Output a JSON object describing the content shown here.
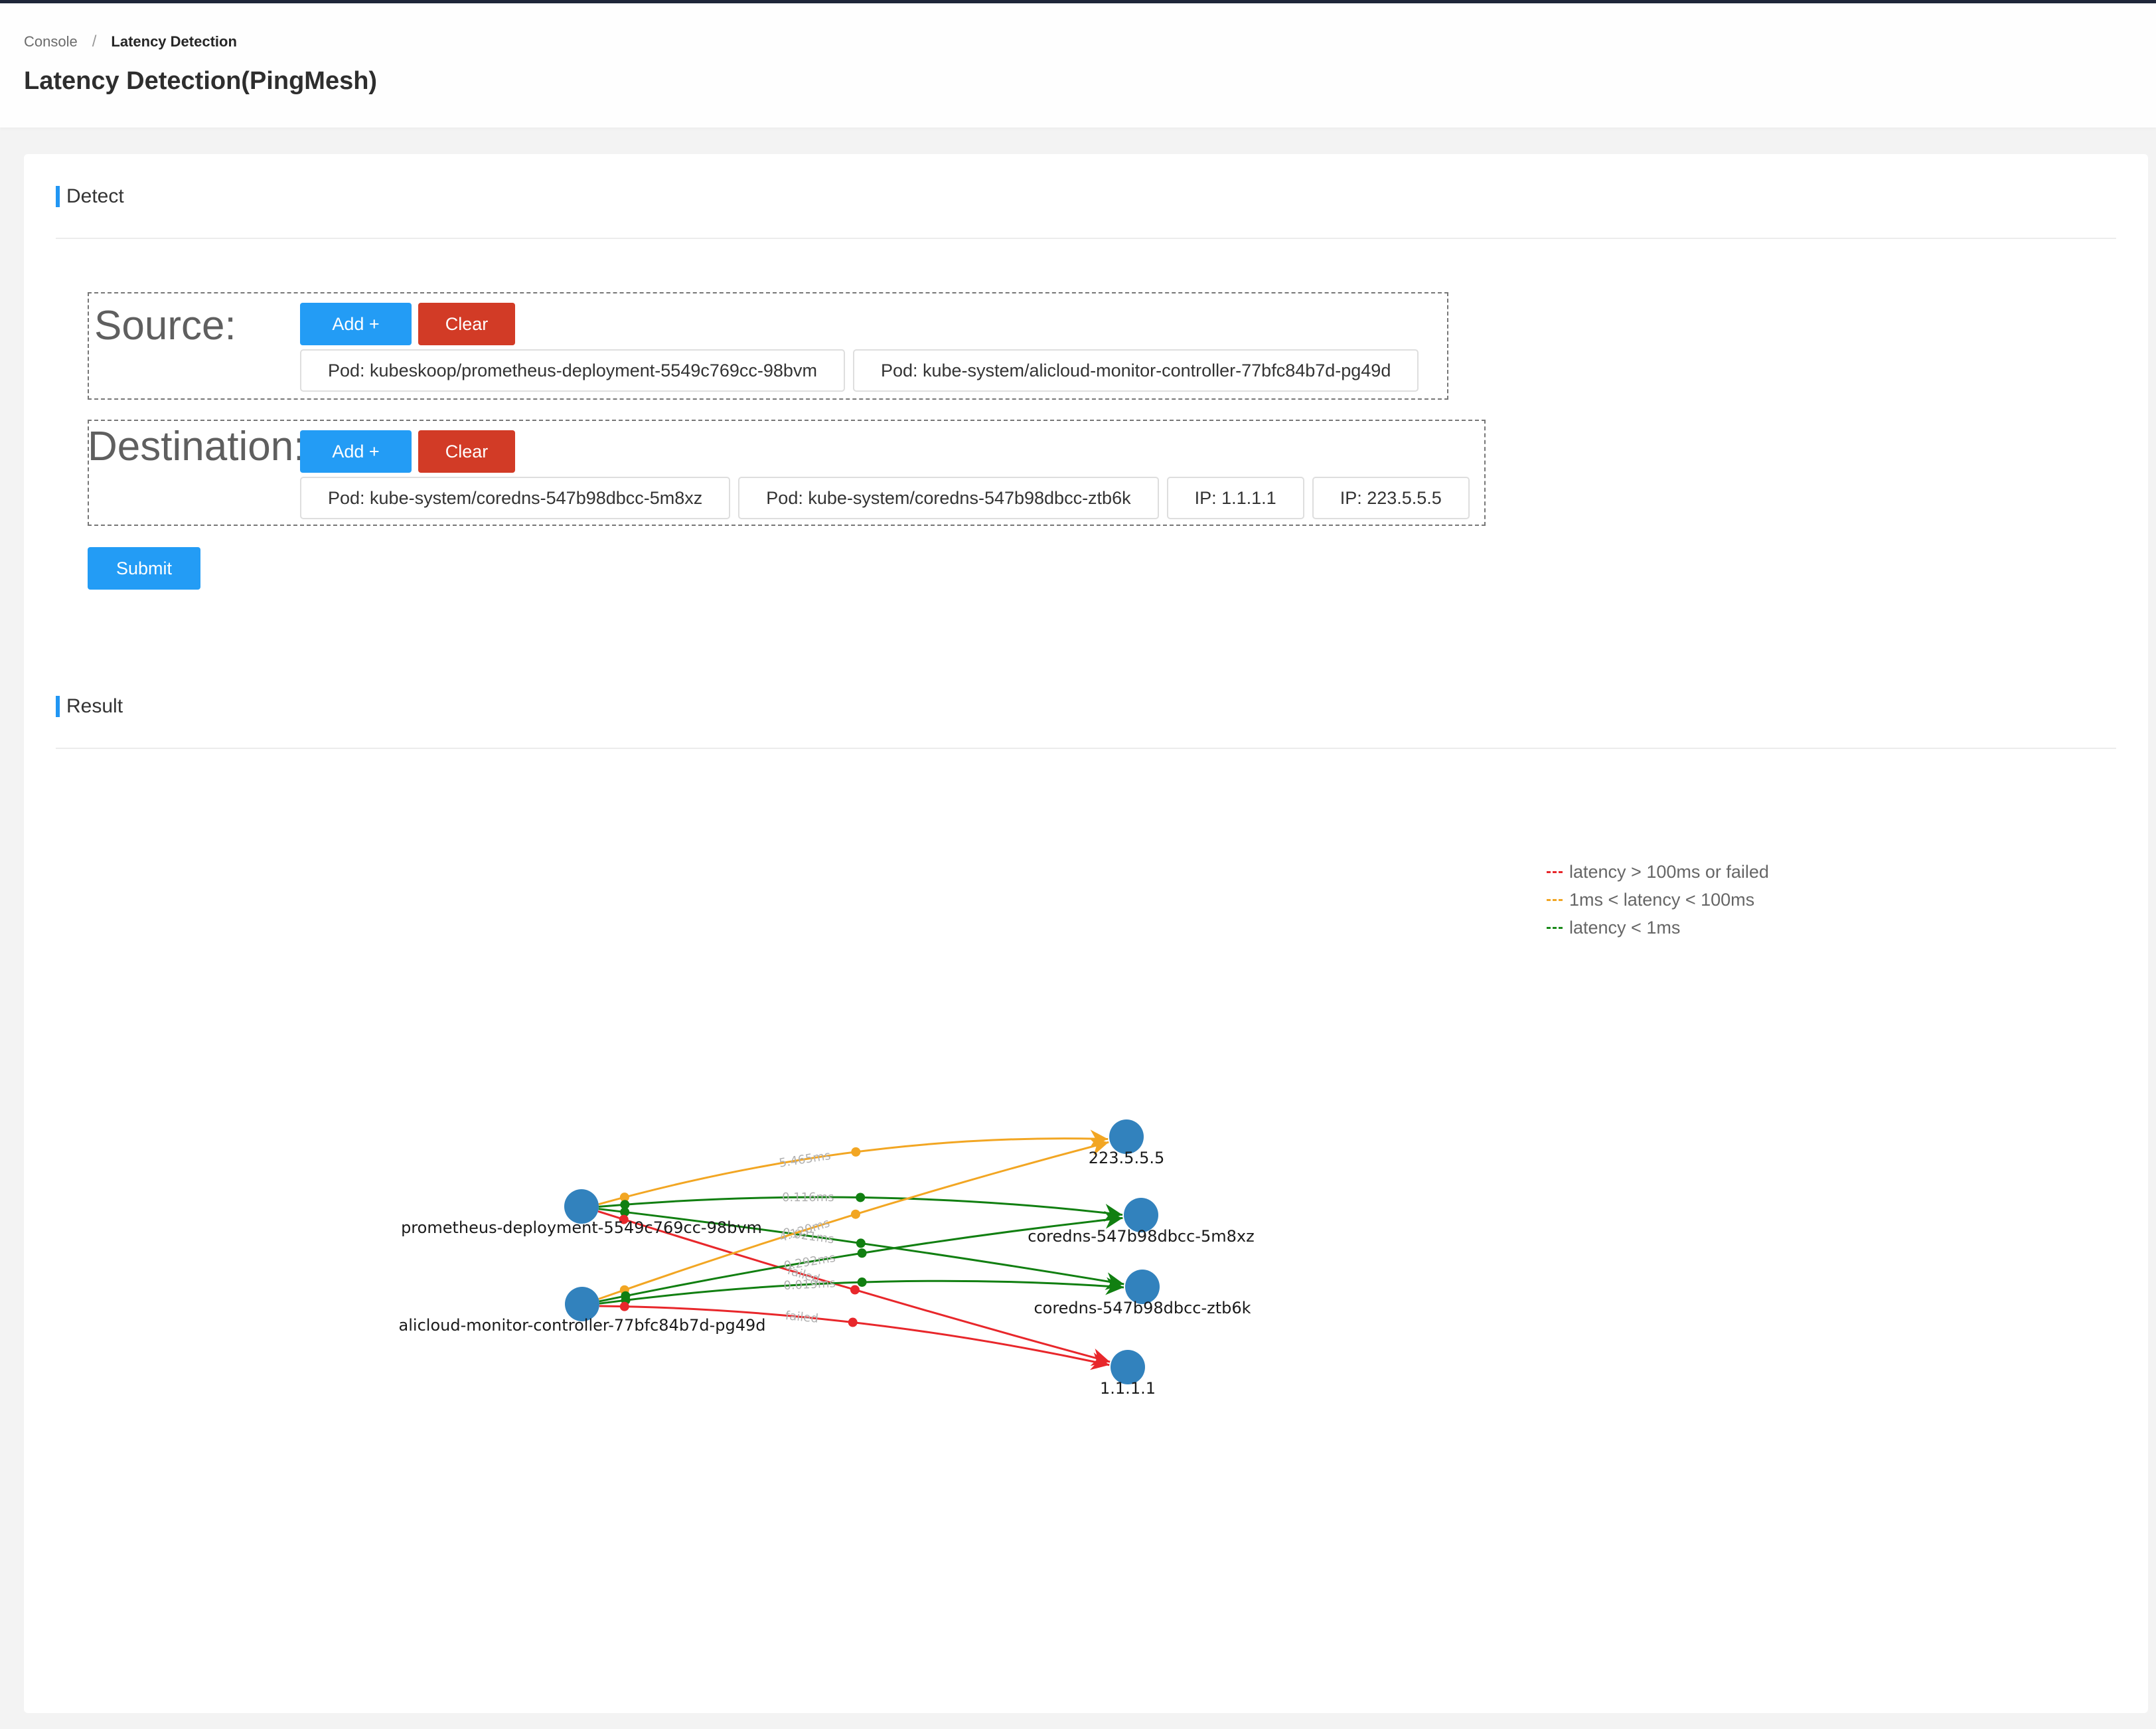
{
  "breadcrumb": {
    "root": "Console",
    "separator": "/",
    "current": "Latency Detection"
  },
  "page": {
    "title": "Latency Detection(PingMesh)"
  },
  "detect": {
    "title": "Detect",
    "source": {
      "label": "Source:",
      "add_label": "Add +",
      "clear_label": "Clear",
      "items": [
        "Pod: kubeskoop/prometheus-deployment-5549c769cc-98bvm",
        "Pod: kube-system/alicloud-monitor-controller-77bfc84b7d-pg49d"
      ]
    },
    "destination": {
      "label": "Destination:",
      "add_label": "Add +",
      "clear_label": "Clear",
      "items": [
        "Pod: kube-system/coredns-547b98dbcc-5m8xz",
        "Pod: kube-system/coredns-547b98dbcc-ztb6k",
        "IP: 1.1.1.1",
        "IP: 223.5.5.5"
      ]
    },
    "submit_label": "Submit"
  },
  "result": {
    "title": "Result",
    "legend": [
      {
        "label": "latency > 100ms or failed",
        "color": "#e8272b"
      },
      {
        "label": "1ms < latency < 100ms",
        "color": "#f2a623"
      },
      {
        "label": "latency < 1ms",
        "color": "#1a8a1a"
      }
    ],
    "colors": {
      "node": "#3282bd",
      "failed": "#e8272b",
      "slow": "#f2a623",
      "fast": "#117f11"
    },
    "graph": {
      "nodes": [
        {
          "id": "prom",
          "label": "prometheus-deployment-5549c769cc-98bvm",
          "role": "source"
        },
        {
          "id": "ali",
          "label": "alicloud-monitor-controller-77bfc84b7d-pg49d",
          "role": "source"
        },
        {
          "id": "ip223",
          "label": "223.5.5.5",
          "role": "destination"
        },
        {
          "id": "dns1",
          "label": "coredns-547b98dbcc-5m8xz",
          "role": "destination"
        },
        {
          "id": "dns2",
          "label": "coredns-547b98dbcc-ztb6k",
          "role": "destination"
        },
        {
          "id": "ip111",
          "label": "1.1.1.1",
          "role": "destination"
        }
      ],
      "edges": [
        {
          "from": "prom",
          "to": "ip223",
          "label": "5.465ms",
          "status": "slow"
        },
        {
          "from": "prom",
          "to": "dns1",
          "label": "0.116ms",
          "status": "fast"
        },
        {
          "from": "prom",
          "to": "dns2",
          "label": "0.021ms",
          "status": "fast"
        },
        {
          "from": "prom",
          "to": "ip111",
          "label": "failed",
          "status": "failed"
        },
        {
          "from": "ali",
          "to": "ip223",
          "label": "4.120ms",
          "status": "slow"
        },
        {
          "from": "ali",
          "to": "dns1",
          "label": "0.292ms",
          "status": "fast"
        },
        {
          "from": "ali",
          "to": "dns2",
          "label": "0.019ms",
          "status": "fast"
        },
        {
          "from": "ali",
          "to": "ip111",
          "label": "failed",
          "status": "failed"
        }
      ]
    }
  }
}
